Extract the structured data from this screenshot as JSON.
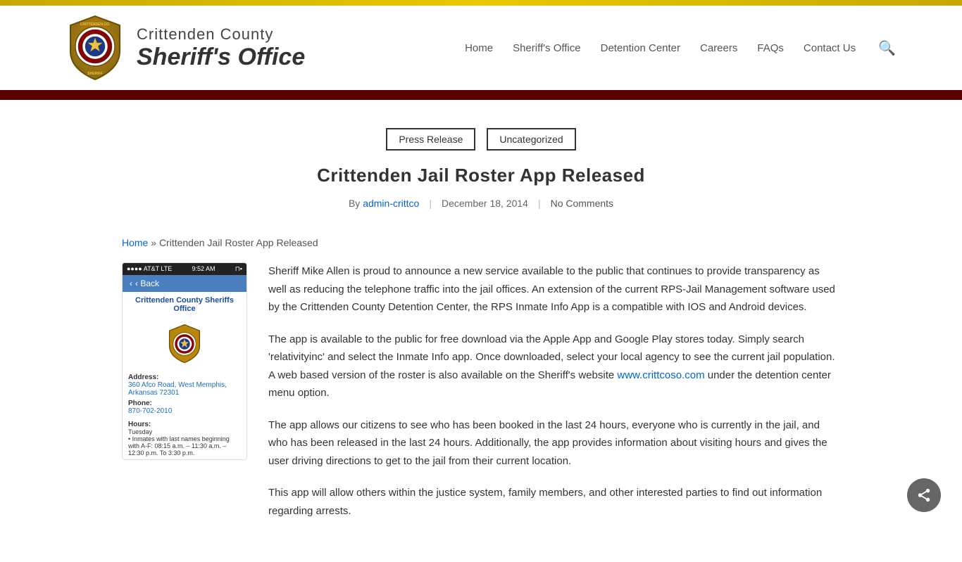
{
  "topBar": {},
  "header": {
    "logoCounty": "Crittenden County",
    "logoOffice": "Sheriff's Office",
    "nav": {
      "home": "Home",
      "sheriffs_office": "Sheriff's Office",
      "detention_center": "Detention Center",
      "careers": "Careers",
      "faqs": "FAQs",
      "contact_us": "Contact Us"
    }
  },
  "article": {
    "tags": [
      "Press Release",
      "Uncategorized"
    ],
    "title": "Crittenden Jail Roster App Released",
    "meta": {
      "by": "By",
      "author": "admin-crittco",
      "date": "December 18, 2014",
      "comments": "No Comments"
    },
    "breadcrumb": {
      "home": "Home",
      "separator": "»",
      "current": "Crittenden Jail Roster App Released"
    },
    "phone": {
      "statusBar": "AT&T  LTE    9:52 AM",
      "backLabel": "‹ Back",
      "appTitle": "Crittenden County Sheriffs Office",
      "addressLabel": "Address:",
      "addressValue": "360 Afco Road, West Memphis, Arkansas 72301",
      "phoneLabel": "Phone:",
      "phoneValue": "870-702-2010",
      "hoursLabel": "Hours:",
      "hoursValue": "Tuesday\n• Inmates with last names beginning with A-F: 08:15 a.m. – 11:30 a.m. – 12:30 p.m. To 3:30 p.m."
    },
    "paragraphs": [
      "Sheriff Mike Allen is proud to announce a new service available to the public that continues to provide transparency as well as reducing the telephone traffic into the jail offices.  An extension of the current RPS-Jail Management software used by the Crittenden County Detention Center, the RPS Inmate Info App is a compatible with IOS and Android devices.",
      "The app is available to the public for free download via the Apple App and Google Play stores today.  Simply search 'relativityinc' and select the Inmate Info app.  Once downloaded, select your local agency to see the current jail population.  A web based version of the roster is also available on the Sheriff's website www.crittcoso.com under the detention center menu option.",
      "The app allows our citizens to see who has been booked in the last 24 hours, everyone who is currently in the jail, and who has been released in the last 24 hours.  Additionally, the app provides information about visiting hours and gives the user driving directions to get to the jail from their current location.",
      "This app will allow others within the justice system, family members, and other interested parties to find out information regarding arrests."
    ]
  }
}
